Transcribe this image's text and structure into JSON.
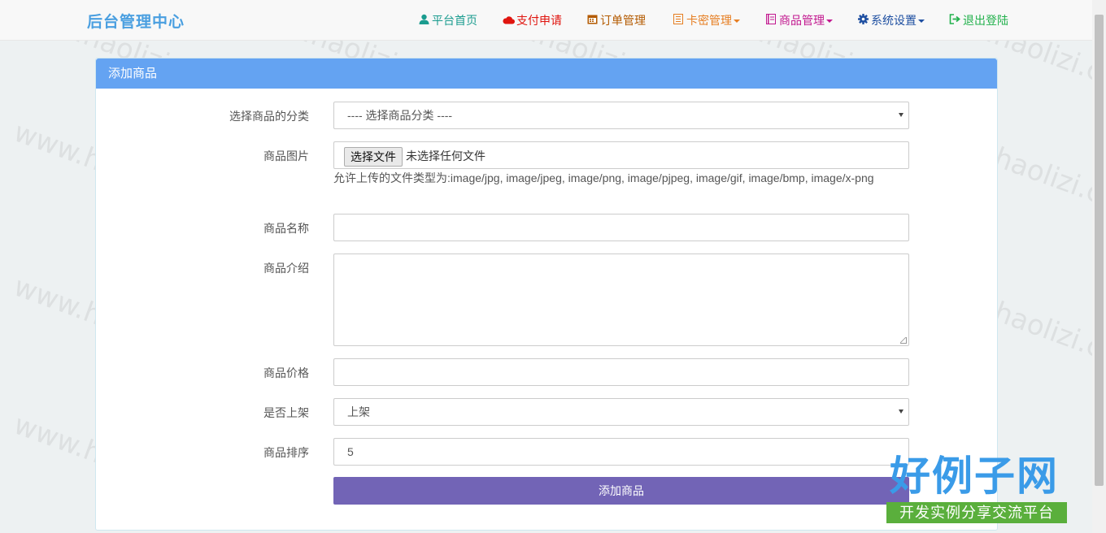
{
  "navbar": {
    "brand": "后台管理中心",
    "items": [
      {
        "label": "平台首页",
        "icon": "user-icon",
        "color": "#1b9c8f"
      },
      {
        "label": "支付申请",
        "icon": "cloud-icon",
        "color": "#e0150f"
      },
      {
        "label": "订单管理",
        "icon": "calendar-icon",
        "color": "#b35a00"
      },
      {
        "label": "卡密管理",
        "icon": "list-icon",
        "color": "#e67e22"
      },
      {
        "label": "商品管理",
        "icon": "book-icon",
        "color": "#c2188f"
      },
      {
        "label": "系统设置",
        "icon": "gear-icon",
        "color": "#1e4fa1"
      },
      {
        "label": "退出登陆",
        "icon": "logout-icon",
        "color": "#22b14c"
      }
    ]
  },
  "panel": {
    "title": "添加商品",
    "header_color": "#64a3f2"
  },
  "form": {
    "category": {
      "label": "选择商品的分类",
      "value": "---- 选择商品分类 ----"
    },
    "image": {
      "label": "商品图片",
      "button": "选择文件",
      "status": "未选择任何文件",
      "help": "允许上传的文件类型为:image/jpg, image/jpeg, image/png, image/pjpeg, image/gif, image/bmp, image/x-png"
    },
    "name": {
      "label": "商品名称",
      "value": ""
    },
    "intro": {
      "label": "商品介绍",
      "value": ""
    },
    "price": {
      "label": "商品价格",
      "value": ""
    },
    "shelf": {
      "label": "是否上架",
      "value": "上架"
    },
    "sort": {
      "label": "商品排序",
      "value": "5"
    },
    "submit": "添加商品",
    "submit_color": "#7264b6"
  },
  "watermark": {
    "text": "www.haolizi.com",
    "logo_big": "好例子网",
    "logo_small": "开发实例分享交流平台"
  }
}
